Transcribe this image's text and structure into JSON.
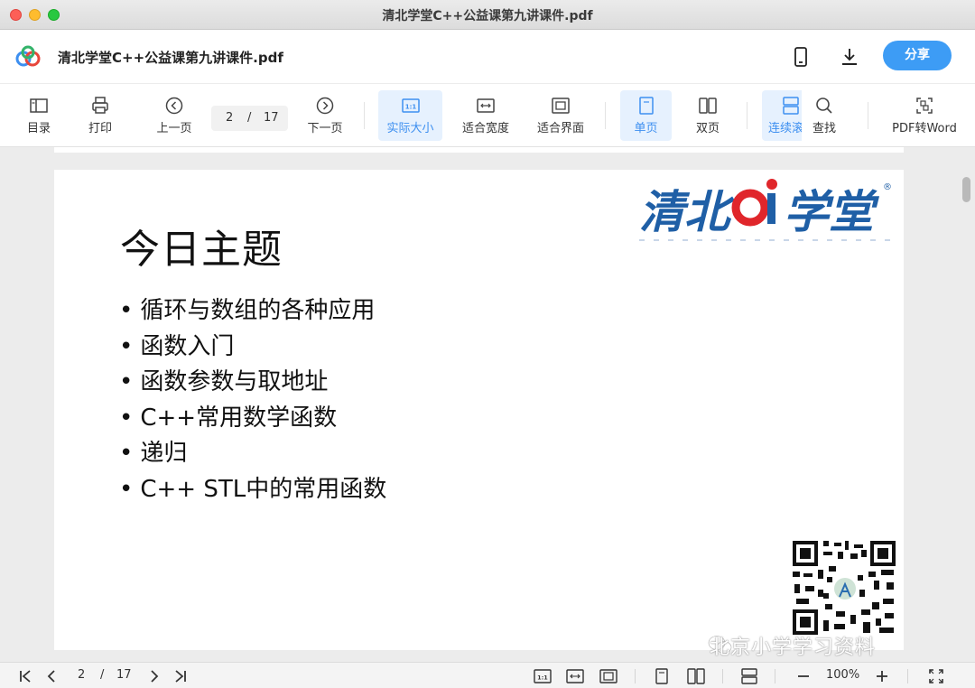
{
  "window": {
    "title": "清北学堂C++公益课第九讲课件.pdf"
  },
  "header": {
    "doc_title": "清北学堂C++公益课第九讲课件.pdf",
    "share_label": "分享"
  },
  "toolbar": {
    "toc": "目录",
    "print": "打印",
    "prev_page": "上一页",
    "current_page": "2",
    "separator": "/",
    "total_pages": "17",
    "next_page": "下一页",
    "actual_size": "实际大小",
    "fit_width": "适合宽度",
    "fit_screen": "适合界面",
    "single_page": "单页",
    "double_page": "双页",
    "continuous": "连续滚",
    "find": "查找",
    "pdf_to_word": "PDF转Word"
  },
  "slide": {
    "title": "今日主题",
    "bullets": [
      "循环与数组的各种应用",
      "函数入门",
      "函数参数与取地址",
      "C++常用数学函数",
      "递归",
      "C++ STL中的常用函数"
    ],
    "logo_text": "清北oi学堂"
  },
  "watermark": {
    "text": "北京小学学习资料"
  },
  "bottom": {
    "current_page": "2",
    "separator": "/",
    "total_pages": "17",
    "zoom": "100%"
  },
  "colors": {
    "accent": "#3d9cf5",
    "active_bg": "#e6f1fe",
    "logo_blue": "#1f5fa6",
    "logo_red": "#e0262b"
  }
}
